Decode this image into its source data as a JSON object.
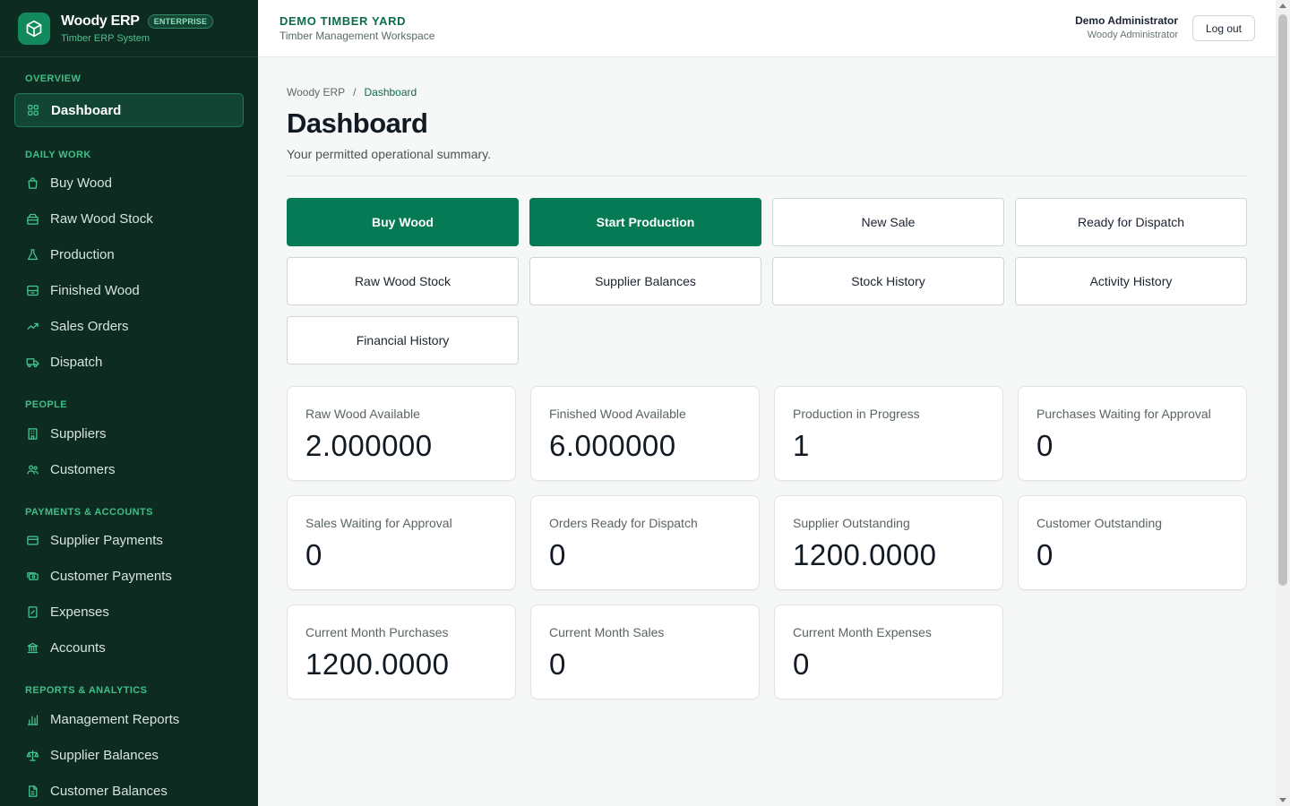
{
  "brand": {
    "name": "Woody ERP",
    "badge": "ENTERPRISE",
    "subtitle": "Timber ERP System",
    "icon": "box-icon"
  },
  "sidebar": {
    "sections": [
      {
        "title": "OVERVIEW",
        "items": [
          {
            "label": "Dashboard",
            "icon": "grid-icon",
            "active": true
          }
        ]
      },
      {
        "title": "DAILY WORK",
        "items": [
          {
            "label": "Buy Wood",
            "icon": "bag-icon"
          },
          {
            "label": "Raw Wood Stock",
            "icon": "crate-icon"
          },
          {
            "label": "Production",
            "icon": "flask-icon"
          },
          {
            "label": "Finished Wood",
            "icon": "package-icon"
          },
          {
            "label": "Sales Orders",
            "icon": "trend-up-icon"
          },
          {
            "label": "Dispatch",
            "icon": "truck-icon"
          }
        ]
      },
      {
        "title": "PEOPLE",
        "items": [
          {
            "label": "Suppliers",
            "icon": "building-icon"
          },
          {
            "label": "Customers",
            "icon": "users-icon"
          }
        ]
      },
      {
        "title": "PAYMENTS & ACCOUNTS",
        "items": [
          {
            "label": "Supplier Payments",
            "icon": "card-icon"
          },
          {
            "label": "Customer Payments",
            "icon": "cash-icon"
          },
          {
            "label": "Expenses",
            "icon": "receipt-icon"
          },
          {
            "label": "Accounts",
            "icon": "bank-icon"
          }
        ]
      },
      {
        "title": "REPORTS & ANALYTICS",
        "items": [
          {
            "label": "Management Reports",
            "icon": "bar-chart-icon"
          },
          {
            "label": "Supplier Balances",
            "icon": "scale-icon"
          },
          {
            "label": "Customer Balances",
            "icon": "document-icon"
          }
        ]
      }
    ]
  },
  "header": {
    "org_name": "DEMO TIMBER YARD",
    "org_subtitle": "Timber Management Workspace",
    "user_name": "Demo Administrator",
    "user_role": "Woody Administrator",
    "logout_label": "Log out"
  },
  "page": {
    "breadcrumb": [
      "Woody ERP",
      "Dashboard"
    ],
    "title": "Dashboard",
    "description": "Your permitted operational summary."
  },
  "actions": [
    {
      "label": "Buy Wood",
      "primary": true
    },
    {
      "label": "Start Production",
      "primary": true
    },
    {
      "label": "New Sale",
      "primary": false
    },
    {
      "label": "Ready for Dispatch",
      "primary": false
    },
    {
      "label": "Raw Wood Stock",
      "primary": false
    },
    {
      "label": "Supplier Balances",
      "primary": false
    },
    {
      "label": "Stock History",
      "primary": false
    },
    {
      "label": "Activity History",
      "primary": false
    },
    {
      "label": "Financial History",
      "primary": false
    }
  ],
  "stats": [
    {
      "label": "Raw Wood Available",
      "value": "2.000000"
    },
    {
      "label": "Finished Wood Available",
      "value": "6.000000"
    },
    {
      "label": "Production in Progress",
      "value": "1"
    },
    {
      "label": "Purchases Waiting for Approval",
      "value": "0"
    },
    {
      "label": "Sales Waiting for Approval",
      "value": "0"
    },
    {
      "label": "Orders Ready for Dispatch",
      "value": "0"
    },
    {
      "label": "Supplier Outstanding",
      "value": "1200.0000"
    },
    {
      "label": "Customer Outstanding",
      "value": "0"
    },
    {
      "label": "Current Month Purchases",
      "value": "1200.0000"
    },
    {
      "label": "Current Month Sales",
      "value": "0"
    },
    {
      "label": "Current Month Expenses",
      "value": "0"
    }
  ],
  "colors": {
    "brand_green": "#067a55",
    "sidebar_bg": "#0d2b21",
    "sidebar_section": "#3fbf86"
  }
}
